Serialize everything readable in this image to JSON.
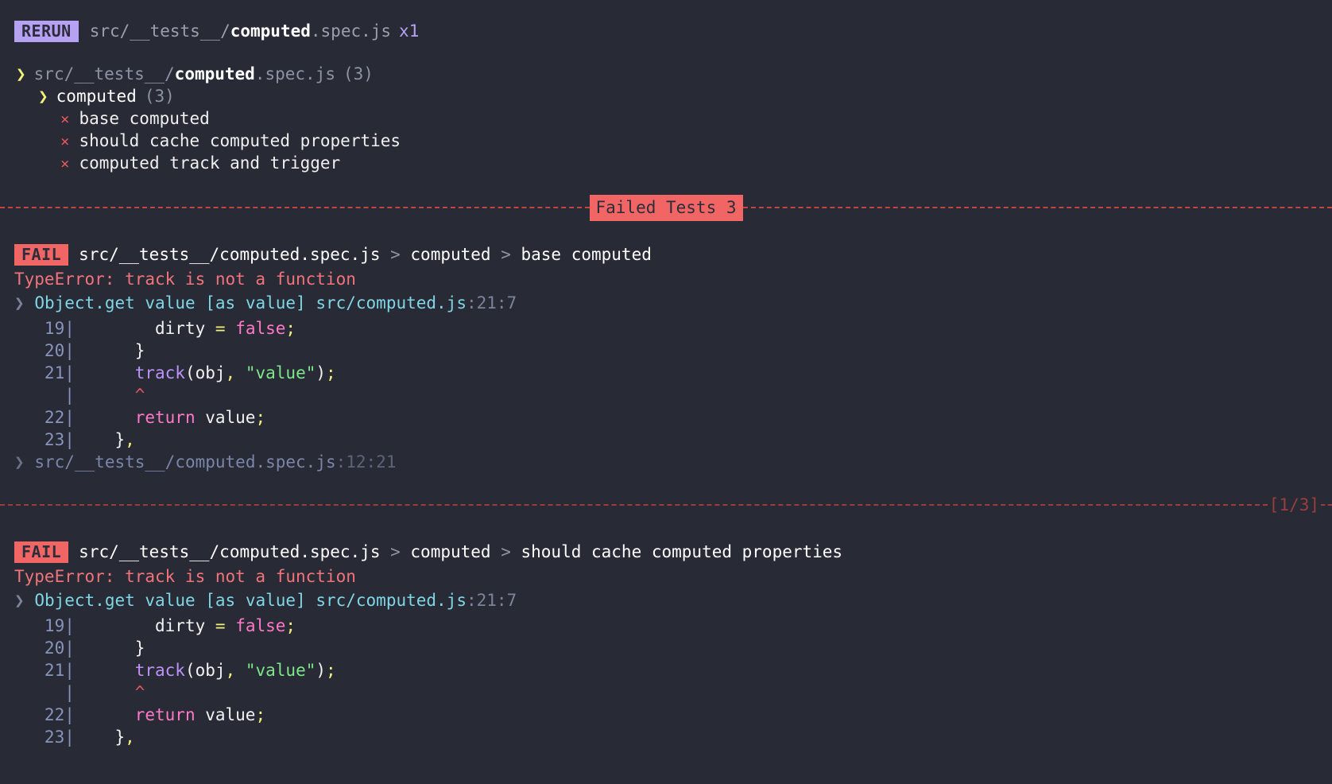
{
  "rerun": {
    "badge": "RERUN",
    "path_prefix": "src/__tests__/",
    "path_highlight": "computed",
    "path_suffix": ".spec.js",
    "count": "x1"
  },
  "tree": {
    "file_row": {
      "chevron": "❯",
      "prefix": "src/__tests__/",
      "highlight": "computed",
      "suffix": ".spec.js",
      "count": "(3)"
    },
    "suite_row": {
      "chevron": "❯",
      "name": "computed",
      "count": "(3)"
    },
    "tests": [
      {
        "mark": "×",
        "name": "base computed"
      },
      {
        "mark": "×",
        "name": "should cache computed properties"
      },
      {
        "mark": "×",
        "name": "computed track and trigger"
      }
    ]
  },
  "banner": {
    "label": "Failed Tests 3"
  },
  "failures": [
    {
      "badge": "FAIL",
      "file": "src/__tests__/computed.spec.js",
      "sep": " > ",
      "suite": "computed",
      "test": "base computed",
      "error": "TypeError: track is not a function",
      "stack_main": {
        "chevron": "❯",
        "fn": "Object.get value [as value] src/computed.js",
        "loc": ":21:7"
      },
      "code": [
        {
          "lno": "19",
          "bar": "|",
          "tokens": [
            {
              "t": "        dirty ",
              "c": "c-white"
            },
            {
              "t": "=",
              "c": "c-op"
            },
            {
              "t": " ",
              "c": "c-white"
            },
            {
              "t": "false",
              "c": "c-kw"
            },
            {
              "t": ";",
              "c": "c-op"
            }
          ]
        },
        {
          "lno": "20",
          "bar": "|",
          "tokens": [
            {
              "t": "      }",
              "c": "c-white"
            }
          ]
        },
        {
          "lno": "21",
          "bar": "|",
          "tokens": [
            {
              "t": "      ",
              "c": "c-white"
            },
            {
              "t": "track",
              "c": "c-fn"
            },
            {
              "t": "(",
              "c": "c-punc"
            },
            {
              "t": "obj",
              "c": "c-white"
            },
            {
              "t": ",",
              "c": "c-op"
            },
            {
              "t": " ",
              "c": "c-white"
            },
            {
              "t": "\"value\"",
              "c": "c-str"
            },
            {
              "t": ")",
              "c": "c-punc"
            },
            {
              "t": ";",
              "c": "c-op"
            }
          ]
        },
        {
          "lno": "  ",
          "bar": "|",
          "tokens": [
            {
              "t": "      ",
              "c": "c-white"
            },
            {
              "t": "^",
              "c": "caret"
            }
          ]
        },
        {
          "lno": "22",
          "bar": "|",
          "tokens": [
            {
              "t": "      ",
              "c": "c-white"
            },
            {
              "t": "return",
              "c": "c-kw"
            },
            {
              "t": " value",
              "c": "c-white"
            },
            {
              "t": ";",
              "c": "c-op"
            }
          ]
        },
        {
          "lno": "23",
          "bar": "|",
          "tokens": [
            {
              "t": "    }",
              "c": "c-white"
            },
            {
              "t": ",",
              "c": "c-op"
            }
          ]
        }
      ],
      "stack_dim": {
        "chevron": "❯",
        "path": "src/__tests__/computed.spec.js",
        "loc": ":12:21"
      }
    },
    {
      "badge": "FAIL",
      "file": "src/__tests__/computed.spec.js",
      "sep": " > ",
      "suite": "computed",
      "test": "should cache computed properties",
      "error": "TypeError: track is not a function",
      "stack_main": {
        "chevron": "❯",
        "fn": "Object.get value [as value] src/computed.js",
        "loc": ":21:7"
      },
      "code": [
        {
          "lno": "19",
          "bar": "|",
          "tokens": [
            {
              "t": "        dirty ",
              "c": "c-white"
            },
            {
              "t": "=",
              "c": "c-op"
            },
            {
              "t": " ",
              "c": "c-white"
            },
            {
              "t": "false",
              "c": "c-kw"
            },
            {
              "t": ";",
              "c": "c-op"
            }
          ]
        },
        {
          "lno": "20",
          "bar": "|",
          "tokens": [
            {
              "t": "      }",
              "c": "c-white"
            }
          ]
        },
        {
          "lno": "21",
          "bar": "|",
          "tokens": [
            {
              "t": "      ",
              "c": "c-white"
            },
            {
              "t": "track",
              "c": "c-fn"
            },
            {
              "t": "(",
              "c": "c-punc"
            },
            {
              "t": "obj",
              "c": "c-white"
            },
            {
              "t": ",",
              "c": "c-op"
            },
            {
              "t": " ",
              "c": "c-white"
            },
            {
              "t": "\"value\"",
              "c": "c-str"
            },
            {
              "t": ")",
              "c": "c-punc"
            },
            {
              "t": ";",
              "c": "c-op"
            }
          ]
        },
        {
          "lno": "  ",
          "bar": "|",
          "tokens": [
            {
              "t": "      ",
              "c": "c-white"
            },
            {
              "t": "^",
              "c": "caret"
            }
          ]
        },
        {
          "lno": "22",
          "bar": "|",
          "tokens": [
            {
              "t": "      ",
              "c": "c-white"
            },
            {
              "t": "return",
              "c": "c-kw"
            },
            {
              "t": " value",
              "c": "c-white"
            },
            {
              "t": ";",
              "c": "c-op"
            }
          ]
        },
        {
          "lno": "23",
          "bar": "|",
          "tokens": [
            {
              "t": "    }",
              "c": "c-white"
            },
            {
              "t": ",",
              "c": "c-op"
            }
          ]
        }
      ]
    }
  ],
  "divider": {
    "counter": "[1/3]"
  },
  "colors": {
    "background": "#282a36",
    "rerun_badge": "#b7a1f3",
    "fail_badge": "#f26565",
    "error_text": "#f0747a",
    "chevron_yellow": "#f2f07a",
    "stack_cyan": "#7fd6e4",
    "divider_red": "#9b3d3d"
  }
}
